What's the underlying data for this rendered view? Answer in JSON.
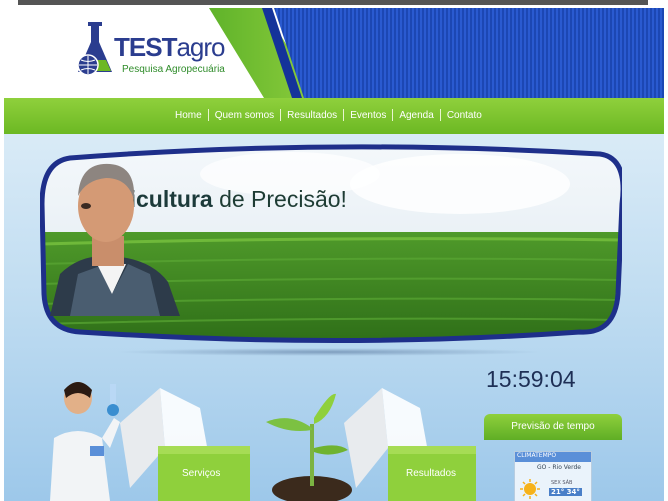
{
  "logo": {
    "brand_bold": "TEST",
    "brand_light": "agro",
    "tagline": "Pesquisa Agropecuária"
  },
  "nav": {
    "items": [
      "Home",
      "Quem somos",
      "Resultados",
      "Eventos",
      "Agenda",
      "Contato"
    ]
  },
  "banner": {
    "title_bold": "Agricultura",
    "title_rest": " de Precisão!"
  },
  "clock": {
    "time": "15:59:04"
  },
  "cards": {
    "services_label": "Serviços",
    "results_label": "Resultados"
  },
  "weather": {
    "title": "Previsão de tempo",
    "brand": "CLIMATEMPO",
    "city": "GO - Rio Verde",
    "days": "SEX  SÁB",
    "temps": "21°  34°"
  },
  "colors": {
    "nav_green": "#79c12f",
    "header_blue": "#1c47b3",
    "accent_navy": "#2b3d8f"
  }
}
